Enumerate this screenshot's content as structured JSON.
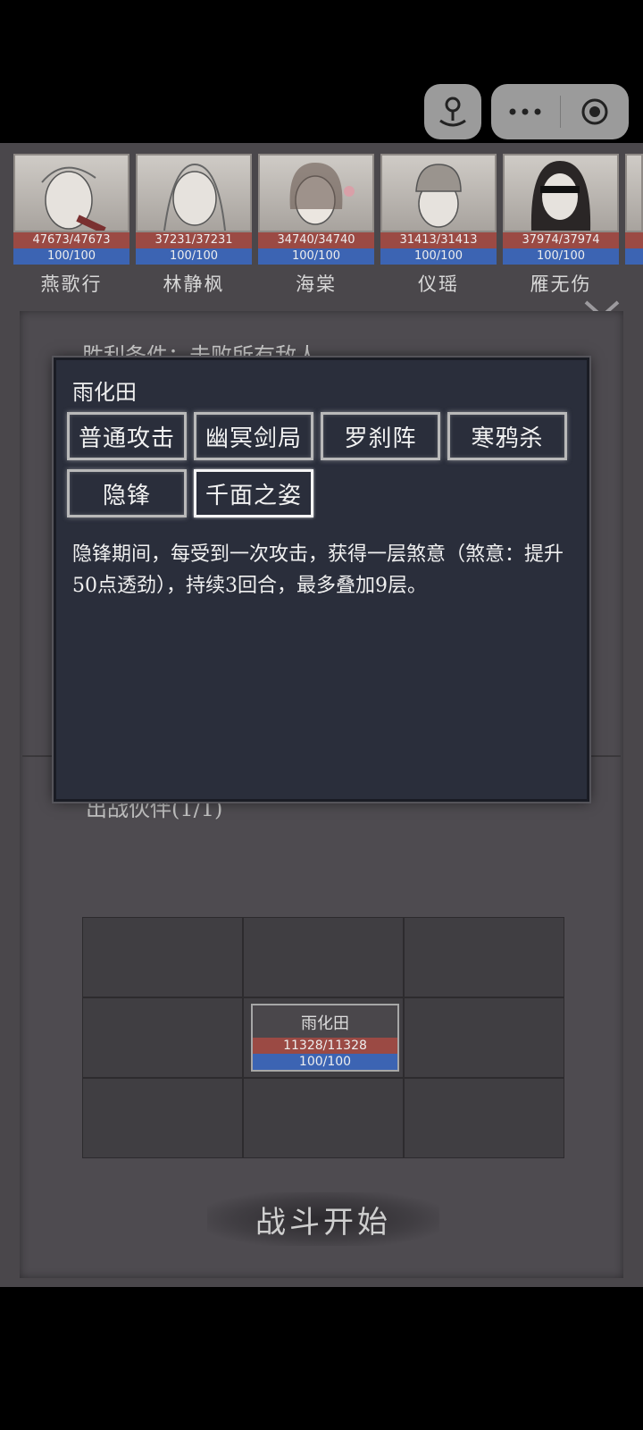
{
  "roster": [
    {
      "name": "燕歌行",
      "hp": "47673/47673",
      "mp": "100/100"
    },
    {
      "name": "林静枫",
      "hp": "37231/37231",
      "mp": "100/100"
    },
    {
      "name": "海棠",
      "hp": "34740/34740",
      "mp": "100/100"
    },
    {
      "name": "仪瑶",
      "hp": "31413/31413",
      "mp": "100/100"
    },
    {
      "name": "雁无伤",
      "hp": "37974/37974",
      "mp": "100/100"
    }
  ],
  "battle": {
    "win_condition": "胜利条件：击败所有敌人",
    "party_title": "出战伙伴(1/1)",
    "start_label": "战斗开始",
    "unit": {
      "name": "雨化田",
      "hp": "11328/11328",
      "mp": "100/100"
    }
  },
  "dialog": {
    "title": "雨化田",
    "skills": [
      "普通攻击",
      "幽冥剑局",
      "罗刹阵",
      "寒鸦杀",
      "隐锋",
      "千面之姿"
    ],
    "selected_skill": "千面之姿",
    "description": "隐锋期间，每受到一次攻击，获得一层煞意（煞意：提升50点透劲），持续3回合，最多叠加9层。"
  },
  "icons": {
    "top_left": "joystick-icon",
    "menu": "more-dots-icon",
    "close": "target-circle-icon",
    "expand": "chevron-down-icon"
  }
}
